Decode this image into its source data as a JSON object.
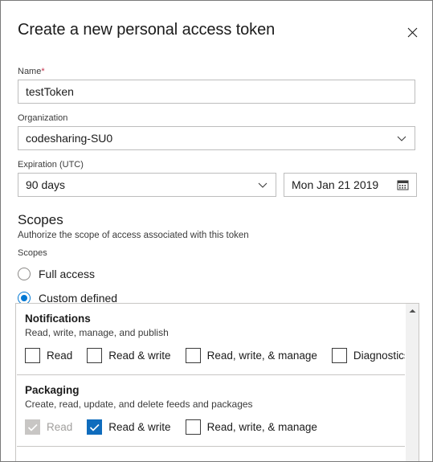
{
  "dialog": {
    "title": "Create a new personal access token",
    "close_label": "Close"
  },
  "form": {
    "name": {
      "label": "Name",
      "required_marker": "*",
      "value": "testToken"
    },
    "organization": {
      "label": "Organization",
      "value": "codesharing-SU0"
    },
    "expiration": {
      "label": "Expiration (UTC)",
      "duration_value": "90 days",
      "date_value": "Mon Jan 21 2019"
    }
  },
  "scopes": {
    "heading": "Scopes",
    "subheading": "Authorize the scope of access associated with this token",
    "group_label": "Scopes",
    "options": [
      {
        "label": "Full access",
        "selected": false
      },
      {
        "label": "Custom defined",
        "selected": true
      }
    ],
    "items": [
      {
        "name": "Notifications",
        "description": "Read, write, manage, and publish",
        "checkboxes": [
          {
            "label": "Read",
            "checked": false,
            "disabled": false
          },
          {
            "label": "Read & write",
            "checked": false,
            "disabled": false
          },
          {
            "label": "Read, write, & manage",
            "checked": false,
            "disabled": false
          },
          {
            "label": "Diagnostics",
            "checked": false,
            "disabled": false
          }
        ]
      },
      {
        "name": "Packaging",
        "description": "Create, read, update, and delete feeds and packages",
        "checkboxes": [
          {
            "label": "Read",
            "checked": true,
            "disabled": true
          },
          {
            "label": "Read & write",
            "checked": true,
            "disabled": false
          },
          {
            "label": "Read, write, & manage",
            "checked": false,
            "disabled": false
          }
        ]
      }
    ]
  },
  "colors": {
    "accent": "#0078d4",
    "checkbox_checked": "#0f6cbd",
    "required_star": "#c4314b",
    "text": "#1b1b1b",
    "border": "#bdbdbd"
  }
}
